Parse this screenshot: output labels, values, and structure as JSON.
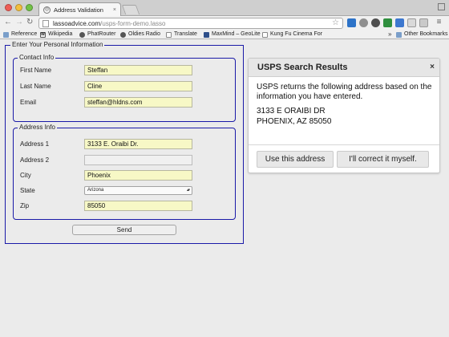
{
  "browser": {
    "tab_title": "Address Validation",
    "tab_close": "×",
    "url_host": "lassoadvice.com",
    "url_path": "/usps-form-demo.lasso",
    "bookmarks": [
      "Reference",
      "Wikipedia",
      "PhatRouter",
      "Oldies Radio",
      "Translate",
      "MaxMind – GeoLite",
      "Kung Fu Cinema For"
    ],
    "other_bookmarks": "Other Bookmarks",
    "chevron": "»"
  },
  "form": {
    "outer_legend": "Enter Your Personal Information",
    "contact_legend": "Contact Info",
    "address_legend": "Address Info",
    "contact_fields": [
      {
        "label": "First Name",
        "value": "Steffan"
      },
      {
        "label": "Last Name",
        "value": "Cline"
      },
      {
        "label": "Email",
        "value": "steffan@hldns.com"
      }
    ],
    "address_fields": [
      {
        "label": "Address 1",
        "value": "3133 E. Oraibi Dr."
      },
      {
        "label": "Address 2",
        "value": ""
      },
      {
        "label": "City",
        "value": "Phoenix"
      },
      {
        "label": "State",
        "value": "Arizona"
      },
      {
        "label": "Zip",
        "value": "85050"
      }
    ],
    "send_label": "Send"
  },
  "results": {
    "title": "USPS Search Results",
    "close": "×",
    "message": "USPS returns the following address based on the information you have entered.",
    "address_line1": "3133 E ORAIBI DR",
    "address_line2": "PHOENIX, AZ 85050",
    "use_label": "Use this address",
    "correct_label": "I'll correct it myself."
  },
  "colors": {
    "fieldset_border": "#1a1aa8",
    "input_fill": "#f7f8c6",
    "page_background": "#ebebeb"
  }
}
